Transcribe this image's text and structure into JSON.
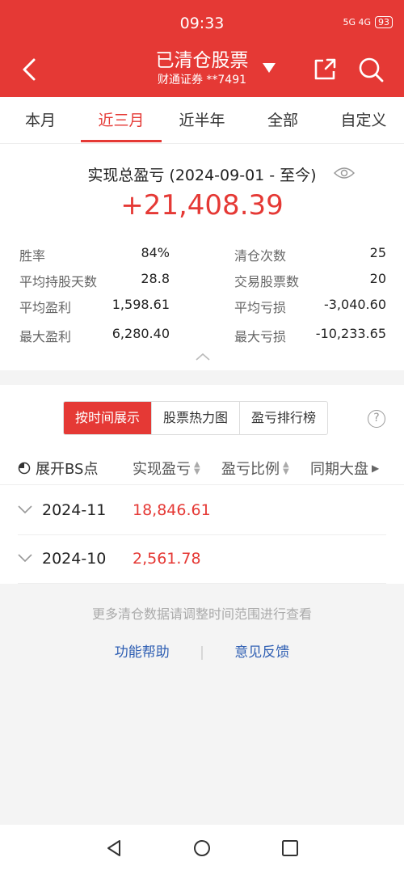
{
  "status_bar": {
    "time": "09:33",
    "network": "5G  4G",
    "battery": "93"
  },
  "header": {
    "title": "已清仓股票",
    "account": "财通证券 **7491"
  },
  "tabs": [
    {
      "label": "本月"
    },
    {
      "label": "近三月"
    },
    {
      "label": "近半年"
    },
    {
      "label": "全部"
    },
    {
      "label": "自定义"
    }
  ],
  "active_tab": "近三月",
  "summary": {
    "label": "实现总盈亏 (2024-09-01 - 至今)",
    "total": "+21,408.39",
    "stats_left": [
      {
        "k": "胜率",
        "v": "84%"
      },
      {
        "k": "平均持股天数",
        "v": "28.8"
      },
      {
        "k": "平均盈利",
        "v": "1,598.61"
      },
      {
        "k": "最大盈利",
        "v": "6,280.40"
      }
    ],
    "stats_right": [
      {
        "k": "清仓次数",
        "v": "25"
      },
      {
        "k": "交易股票数",
        "v": "20"
      },
      {
        "k": "平均亏损",
        "v": "-3,040.60"
      },
      {
        "k": "最大亏损",
        "v": "-10,233.65"
      }
    ]
  },
  "segments": [
    {
      "label": "按时间展示"
    },
    {
      "label": "股票热力图"
    },
    {
      "label": "盈亏排行榜"
    }
  ],
  "help_label": "?",
  "columns": {
    "bs": "展开BS点",
    "profit": "实现盈亏",
    "ratio": "盈亏比例",
    "market": "同期大盘"
  },
  "rows": [
    {
      "date": "2024-11",
      "value": "18,846.61"
    },
    {
      "date": "2024-10",
      "value": "2,561.78"
    }
  ],
  "footer": {
    "note": "更多清仓数据请调整时间范围进行查看",
    "help_link": "功能帮助",
    "feedback_link": "意见反馈"
  },
  "colors": {
    "brand_red": "#e53935",
    "link_blue": "#2f5fb3"
  }
}
